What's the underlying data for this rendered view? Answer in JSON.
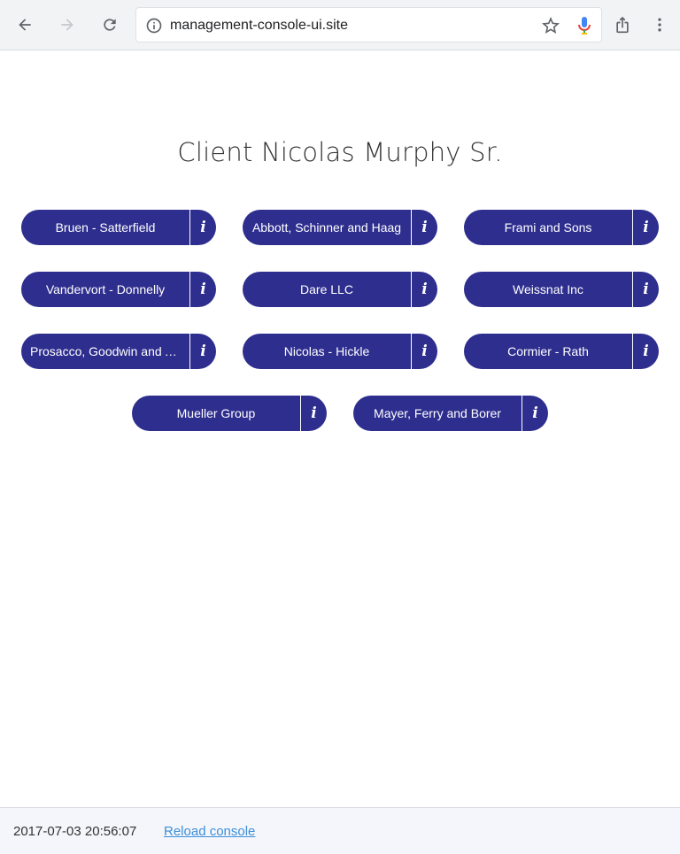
{
  "browser": {
    "url": "management-console-ui.site",
    "icons": [
      "back-arrow-icon",
      "forward-arrow-icon",
      "reload-icon",
      "info-icon",
      "star-icon",
      "mic-icon",
      "share-icon",
      "more-vert-icon"
    ]
  },
  "page": {
    "title": "Client Nicolas Murphy Sr.",
    "info_glyph": "i",
    "companies": [
      {
        "name": "Bruen - Satterfield"
      },
      {
        "name": "Abbott, Schinner and Haag"
      },
      {
        "name": "Frami and Sons"
      },
      {
        "name": "Vandervort - Donnelly"
      },
      {
        "name": "Dare LLC"
      },
      {
        "name": "Weissnat Inc"
      },
      {
        "name": "Prosacco, Goodwin and A…"
      },
      {
        "name": "Nicolas - Hickle"
      },
      {
        "name": "Cormier - Rath"
      },
      {
        "name": "Mueller Group"
      },
      {
        "name": "Mayer, Ferry and Borer"
      }
    ]
  },
  "footer": {
    "timestamp": "2017-07-03 20:56:07",
    "reload_label": "Reload console"
  },
  "colors": {
    "pill": "#2e2e8f",
    "link": "#3a8fd9"
  }
}
